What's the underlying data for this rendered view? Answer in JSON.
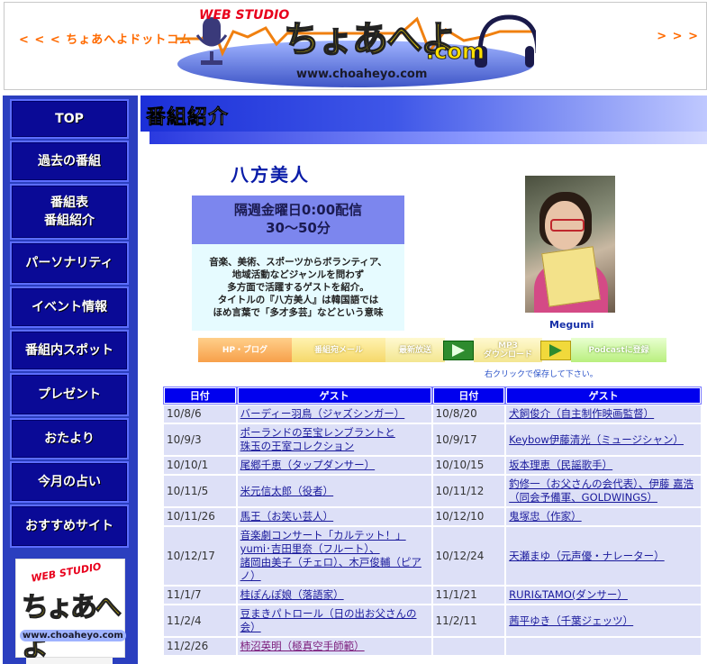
{
  "header": {
    "prev_label": "< < <  ちょあへよドットコム",
    "next_label": "> > >",
    "logo": {
      "studio": "WEB STUDIO",
      "kana": "ちょあへよ",
      "dotcom": ".com",
      "url": "www.choaheyo.com"
    }
  },
  "sidebar": {
    "items": [
      {
        "label": "TOP"
      },
      {
        "label": "過去の番組"
      },
      {
        "label": "番組表\n番組紹介"
      },
      {
        "label": "パーソナリティ"
      },
      {
        "label": "イベント情報"
      },
      {
        "label": "番組内スポット"
      },
      {
        "label": "プレゼント"
      },
      {
        "label": "おたより"
      },
      {
        "label": "今月の占い"
      },
      {
        "label": "おすすめサイト"
      }
    ],
    "logo": {
      "studio": "WEB STUDIO",
      "kana": "ちょあへよ",
      "url": "www.choaheyo.com"
    }
  },
  "main": {
    "section_title": "番組紹介",
    "program_name": "八方美人",
    "schedule": "隔週金曜日0:00配信",
    "duration": "30〜50分",
    "description": "音楽、美術、スポーツからボランティア、\n地域活動などジャンルを問わず\n多方面で活躍するゲストを紹介。\nタイトルの『八方美人』は韓国語では\nほめ言葉で「多才多芸」などという意味",
    "photo_caption": "Megumi",
    "buttons": {
      "hp_blog": "HP・ブログ",
      "mail": "番組宛メール",
      "latest": "最新放送",
      "mp3": "MP3\nダウンロード",
      "podcast": "Podcastに登録"
    },
    "save_note": "右クリックで保存して下さい。",
    "colors": {
      "accent": "#0000ee",
      "sidebar": "#2b3fbf",
      "table_cell": "#dde0f7"
    }
  },
  "table": {
    "headers": [
      "日付",
      "ゲスト",
      "日付",
      "ゲスト"
    ],
    "rows": [
      {
        "d1": "10/8/6",
        "g1": "バーディー羽鳥（ジャズシンガー）",
        "d2": "10/8/20",
        "g2": "犬飼俊介（自主制作映画監督）"
      },
      {
        "d1": "10/9/3",
        "g1": "ポーランドの至宝レンブラントと\n珠玉の王室コレクション",
        "d2": "10/9/17",
        "g2": "Keybow伊藤清光（ミュージシャン）"
      },
      {
        "d1": "10/10/1",
        "g1": "尾郷千恵（タップダンサー）",
        "d2": "10/10/15",
        "g2": "坂本理恵（民謡歌手）"
      },
      {
        "d1": "10/11/5",
        "g1": "米元信太郎（役者）",
        "d2": "10/11/12",
        "g2": "釣修一（お父さんの会代表）、伊藤 嘉浩（同会予備軍、GOLDWINGS）"
      },
      {
        "d1": "10/11/26",
        "g1": "馬王（お笑い芸人）",
        "d2": "10/12/10",
        "g2": "鬼塚忠（作家）"
      },
      {
        "d1": "10/12/17",
        "g1": "音楽劇コンサート「カルテット！」\nyumi･吉田里奈（フルート）、\n諸岡由美子（チェロ）、木戸俊輔（ピアノ）",
        "d2": "10/12/24",
        "g2": "天瀬まゆ（元声優・ナレーター）"
      },
      {
        "d1": "11/1/7",
        "g1": "桂ぽんぽ娘（落語家）",
        "d2": "11/1/21",
        "g2": "RURI&TAMO(ダンサー）"
      },
      {
        "d1": "11/2/4",
        "g1": "豆まきパトロール（日の出お父さんの会）",
        "d2": "11/2/11",
        "g2": "茜平ゆき（千葉ジェッツ）"
      },
      {
        "d1": "11/2/26",
        "g1": "柿沼英明（極真空手師範）",
        "d2": "",
        "g2": ""
      }
    ]
  }
}
